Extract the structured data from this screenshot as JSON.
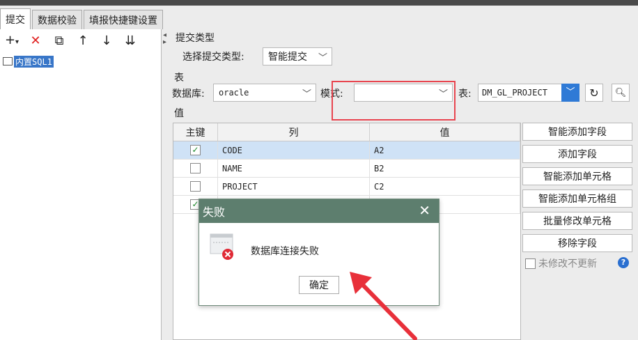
{
  "tabs": [
    "提交",
    "数据校验",
    "填报快捷键设置"
  ],
  "left_toolbar": {
    "icons": [
      "add-icon",
      "delete-icon",
      "copy-icon",
      "move-up-icon",
      "move-down-icon",
      "sort-icon"
    ],
    "add_glyph": "+",
    "dropdown_glyph": "▾",
    "delete_glyph": "✕",
    "copy_glyph": "⧉",
    "up_glyph": "↑",
    "down_glyph": "↓",
    "sort_glyph": "⇊"
  },
  "tree": {
    "items": [
      {
        "label": "内置SQL1"
      }
    ]
  },
  "submit_type": {
    "section_title": "提交类型",
    "label": "选择提交类型:",
    "value": "智能提交"
  },
  "table_section": {
    "section_title": "表",
    "db_label": "数据库:",
    "db_value": "oracle",
    "mode_label": "模式:",
    "mode_value": "",
    "table_label": "表:",
    "table_value": "DM_GL_PROJECT"
  },
  "value_section": {
    "section_title": "值",
    "columns": [
      "主键",
      "列",
      "值"
    ],
    "rows": [
      {
        "key": true,
        "column": "CODE",
        "value": "A2",
        "selected": true
      },
      {
        "key": false,
        "column": "NAME",
        "value": "B2",
        "selected": false
      },
      {
        "key": false,
        "column": "PROJECT",
        "value": "C2",
        "selected": false
      },
      {
        "key": true,
        "column": "",
        "value": "",
        "selected": false
      }
    ]
  },
  "side_buttons": [
    "智能添加字段",
    "添加字段",
    "智能添加单元格",
    "智能添加单元格组",
    "批量修改单元格",
    "移除字段"
  ],
  "no_change_label": "未修改不更新",
  "help_glyph": "?",
  "dialog": {
    "title": "失败",
    "message": "数据库连接失败",
    "ok_label": "确定",
    "close_glyph": "✕"
  },
  "colors": {
    "accent_blue": "#3876c8",
    "dialog_header": "#5d7e6e",
    "highlight_red": "#e8454f",
    "arrow_red": "#e8303a"
  }
}
